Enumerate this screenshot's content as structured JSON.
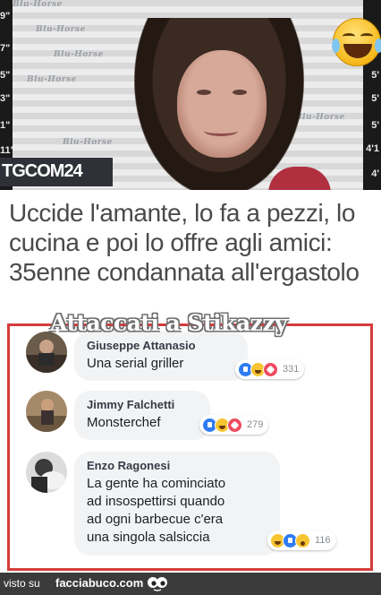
{
  "image": {
    "channel_logo": "TGCOM",
    "channel_logo_num": "24",
    "ruler_left": [
      "9\"",
      "7\"",
      "5\"",
      "3\"",
      "1\"",
      "11\""
    ],
    "ruler_right": [
      "5'",
      "5'",
      "5'",
      "4'1",
      "4'"
    ],
    "backdrop_text": "Blu-Horse",
    "emoji": "laughing-with-tears-emoji"
  },
  "headline": "Uccide l'amante, lo fa a pezzi, lo cucina e poi lo offre agli amici: 35enne condannata all'ergastolo",
  "watermark": "Attaccati a Stikazzy",
  "comments": [
    {
      "author": "Giuseppe Attanasio",
      "text": "Una serial griller",
      "reactions": [
        "like",
        "haha",
        "love"
      ],
      "count": "331"
    },
    {
      "author": "Jimmy Falchetti",
      "text": "Monsterchef",
      "reactions": [
        "like",
        "haha",
        "love"
      ],
      "count": "279"
    },
    {
      "author": "Enzo Ragonesi",
      "text": "La gente ha cominciato\nad insospettirsi quando\nad ogni barbecue c'era\nuna singola salsiccia",
      "reactions": [
        "haha",
        "like",
        "wow"
      ],
      "count": "116"
    }
  ],
  "footer": {
    "prefix": "visto su",
    "site": "facciabuco.com"
  },
  "colors": {
    "frame_red": "#d53c3c",
    "footer_bg": "#3b3b3b",
    "headline_text": "#4a4a4a"
  }
}
